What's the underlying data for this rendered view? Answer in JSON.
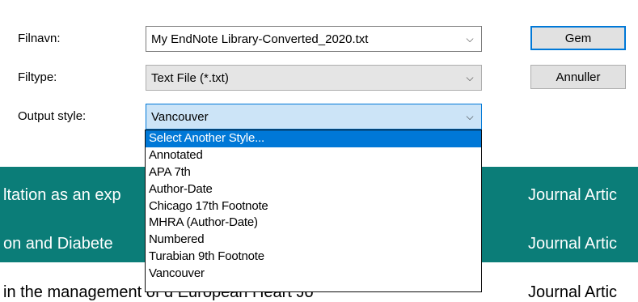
{
  "dialog": {
    "filename_label": "Filnavn:",
    "filename_value": "My EndNote Library-Converted_2020.txt",
    "filetype_label": "Filtype:",
    "filetype_value": "Text File (*.txt)",
    "output_label": "Output style:",
    "output_value": "Vancouver",
    "save_label": "Gem",
    "cancel_label": "Annuller"
  },
  "style_options": [
    "Select Another Style...",
    "Annotated",
    "APA 7th",
    "Author-Date",
    "Chicago 17th Footnote",
    "MHRA (Author-Date)",
    "Numbered",
    "Turabian 9th Footnote",
    "Vancouver"
  ],
  "background_rows": [
    {
      "left": "ltation as an exp",
      "right": "Journal Artic"
    },
    {
      "left": "on and Diabete",
      "right": "Journal Artic"
    },
    {
      "left": "in the management of d     European Heart Jo   ",
      "right": "Journal Artic"
    }
  ],
  "colors": {
    "accent": "#0078d7",
    "teal": "#0b7d78"
  }
}
